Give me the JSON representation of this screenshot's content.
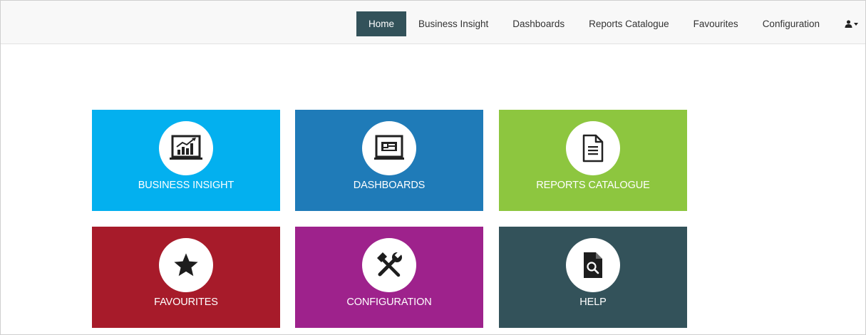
{
  "nav": {
    "items": [
      {
        "label": "Home",
        "active": true
      },
      {
        "label": "Business Insight",
        "active": false
      },
      {
        "label": "Dashboards",
        "active": false
      },
      {
        "label": "Reports Catalogue",
        "active": false
      },
      {
        "label": "Favourites",
        "active": false
      },
      {
        "label": "Configuration",
        "active": false
      }
    ],
    "user_icon": "user-icon",
    "active_color": "#33525a"
  },
  "tiles": [
    {
      "label": "BUSINESS INSIGHT",
      "color": "#03b0ef",
      "icon": "chart-monitor-icon"
    },
    {
      "label": "DASHBOARDS",
      "color": "#1f7bb8",
      "icon": "dashboard-monitor-icon"
    },
    {
      "label": "REPORTS CATALOGUE",
      "color": "#8dc63f",
      "icon": "document-icon"
    },
    {
      "label": "FAVOURITES",
      "color": "#a71b2a",
      "icon": "star-icon"
    },
    {
      "label": "CONFIGURATION",
      "color": "#9e228c",
      "icon": "tools-icon"
    },
    {
      "label": "HELP",
      "color": "#33525a",
      "icon": "search-document-icon"
    }
  ]
}
